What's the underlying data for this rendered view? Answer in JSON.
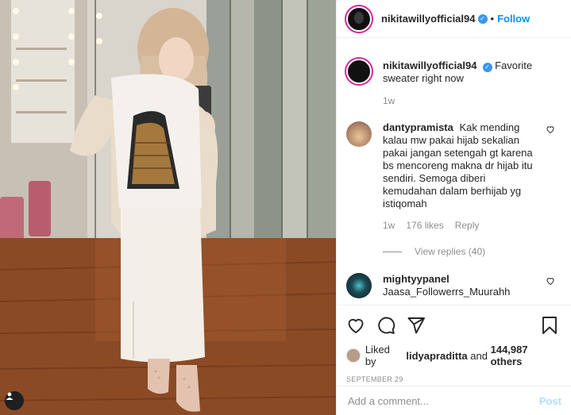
{
  "header": {
    "username": "nikitawillyofficial94",
    "separator": "•",
    "follow_label": "Follow"
  },
  "caption": {
    "username": "nikitawillyofficial94",
    "text": "Favorite sweater right now",
    "time": "1w"
  },
  "comments": [
    {
      "username": "dantypramista",
      "text": "Kak mending kalau mw pakai hijab sekalian pakai jangan setengah gt karena bs mencoreng makna dr hijab itu sendiri. Semoga diberi kemudahan dalam berhijab yg istiqomah",
      "time": "1w",
      "likes": "176 likes",
      "reply_label": "Reply",
      "view_replies": "View replies (40)"
    },
    {
      "username": "mightyypanel",
      "text": "Jaasa_Followerrs_Muurahh"
    }
  ],
  "likes": {
    "prefix": "Liked by",
    "user": "lidyapraditta",
    "and": "and",
    "count": "144,987 others"
  },
  "date": "SEPTEMBER 29",
  "add_comment": {
    "placeholder": "Add a comment...",
    "post_label": "Post"
  },
  "colors": {
    "accent": "#0095f6",
    "verified": "#3897f0",
    "post_disabled": "#b2dffc",
    "muted": "#8e8e8e"
  },
  "icons": [
    "verified-badge-icon",
    "heart-icon",
    "comment-icon",
    "share-icon",
    "bookmark-icon",
    "user-tag-icon"
  ]
}
